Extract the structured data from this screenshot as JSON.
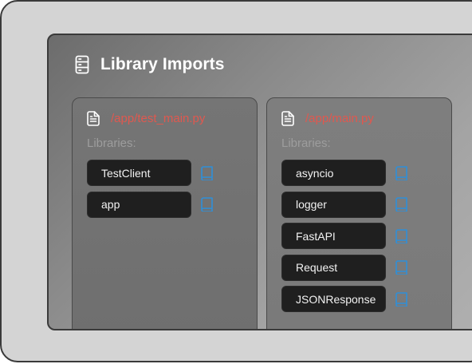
{
  "window": {
    "title": "Library Imports"
  },
  "labels": {
    "libraries": "Libraries:"
  },
  "files": [
    {
      "path": "/app/test_main.py",
      "libraries": [
        "TestClient",
        "app"
      ]
    },
    {
      "path": "/app/main.py",
      "libraries": [
        "asyncio",
        "logger",
        "FastAPI",
        "Request",
        "JSONResponse"
      ]
    }
  ],
  "icons": {
    "header": "server-icon",
    "file": "file-text-icon",
    "doc": "book-icon"
  },
  "colors": {
    "path": "#e0584f",
    "doc_icon": "#2f8fd8",
    "pill_bg": "#1f1f1f",
    "title": "#ffffff"
  }
}
